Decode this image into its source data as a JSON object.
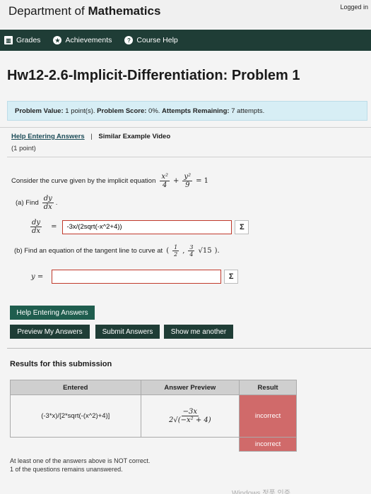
{
  "header": {
    "dept_prefix": "Department of ",
    "dept_bold": "Mathematics",
    "logged_in": "Logged in"
  },
  "nav": {
    "grades": "Grades",
    "achievements": "Achievements",
    "course_help": "Course Help"
  },
  "page_title": "Hw12-2.6-Implicit-Differentiation: Problem 1",
  "problem_info": {
    "value_label": "Problem Value:",
    "value": "1 point(s).",
    "score_label": "Problem Score:",
    "score": "0%.",
    "attempts_label": "Attempts Remaining:",
    "attempts": "7 attempts."
  },
  "help": {
    "help_entering": "Help Entering Answers",
    "separator": "|",
    "similar_video": "Similar Example Video",
    "point": "(1 point)"
  },
  "question": {
    "intro": "Consider the curve given by the implicit equation",
    "eq_x_num": "x²",
    "eq_x_den": "4",
    "eq_plus": "+",
    "eq_y_num": "y²",
    "eq_y_den": "9",
    "eq_rhs": "= 1",
    "part_a_label": "(a) Find",
    "dy": "dy",
    "dx": "dx",
    "period": ".",
    "eq_sign": "=",
    "answer_a": "-3x/(2sqrt(-x^2+4))",
    "part_b_text": "(b) Find an equation of the tangent line to curve at",
    "point_open": "(",
    "pt_x_num": "1",
    "pt_x_den": "2",
    "comma": ",",
    "pt_y_num": "3",
    "pt_y_den": "4",
    "sqrt15": "√15",
    "point_close": ").",
    "y_label": "y =",
    "answer_b": "",
    "sigma": "Σ"
  },
  "buttons": {
    "help_entering": "Help Entering Answers",
    "preview": "Preview My Answers",
    "submit": "Submit Answers",
    "show_another": "Show me another"
  },
  "results": {
    "heading": "Results for this submission",
    "columns": [
      "Entered",
      "Answer Preview",
      "Result"
    ],
    "row1_entered": "(-3*x)/[2*sqrt(-(x^2)+4)]",
    "row1_preview_num": "−3x",
    "row1_preview_den": "2√(−x² + 4)",
    "row1_result": "incorrect",
    "row2_result": "incorrect"
  },
  "messages": {
    "line1": "At least one of the answers above is NOT correct.",
    "line2": "1 of the questions remains unanswered."
  },
  "watermark": "Windows 정품 인증"
}
